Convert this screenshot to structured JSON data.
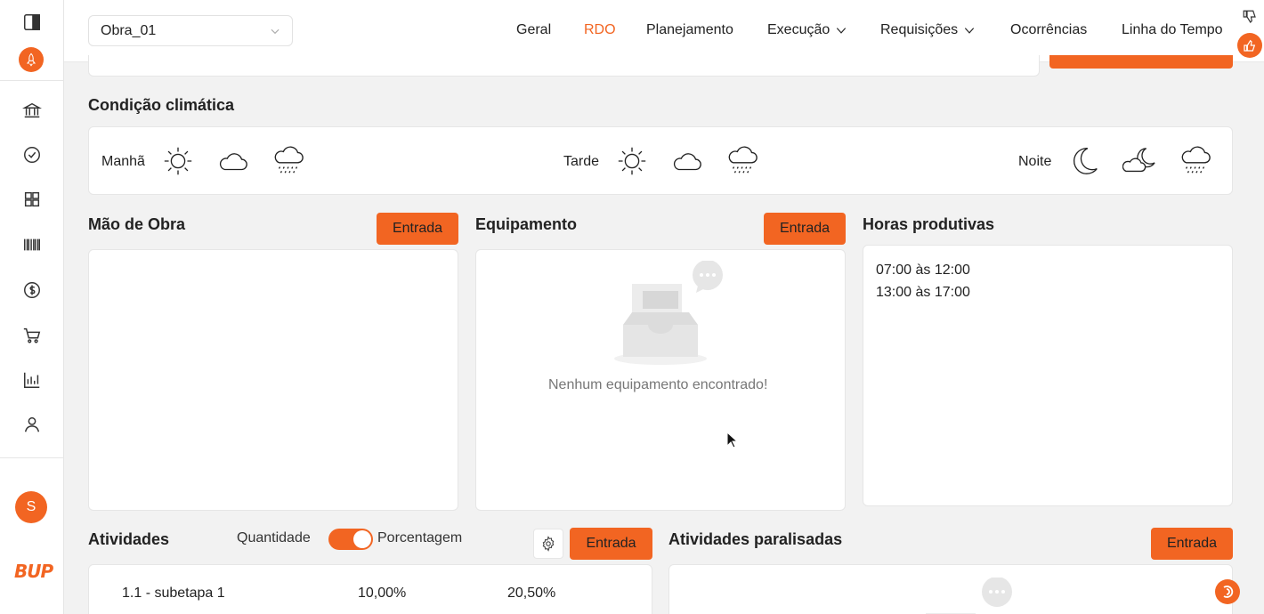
{
  "header": {
    "project": "Obra_01",
    "nav": [
      {
        "label": "Geral",
        "active": false
      },
      {
        "label": "RDO",
        "active": true
      },
      {
        "label": "Planejamento",
        "active": false
      },
      {
        "label": "Execução",
        "active": false,
        "dropdown": true
      },
      {
        "label": "Requisições",
        "active": false,
        "dropdown": true
      },
      {
        "label": "Ocorrências",
        "active": false
      },
      {
        "label": "Linha do Tempo",
        "active": false
      }
    ]
  },
  "sidebar": {
    "icons": [
      "panel-toggle-icon",
      "rocket-icon",
      "bank-icon",
      "check-circle-icon",
      "grid-icon",
      "barcode-icon",
      "dollar-icon",
      "cart-icon",
      "chart-icon",
      "user-icon"
    ],
    "avatar_initial": "S",
    "logo": "BUP"
  },
  "climate": {
    "title": "Condição climática",
    "periods": [
      {
        "label": "Manhã",
        "icons": [
          "sun-icon",
          "cloud-icon",
          "rain-cloud-icon"
        ]
      },
      {
        "label": "Tarde",
        "icons": [
          "sun-icon",
          "cloud-icon",
          "rain-cloud-icon"
        ]
      },
      {
        "label": "Noite",
        "icons": [
          "moon-icon",
          "cloud-moon-icon",
          "rain-cloud-icon"
        ]
      }
    ]
  },
  "labor": {
    "title": "Mão de Obra",
    "button": "Entrada"
  },
  "equipment": {
    "title": "Equipamento",
    "button": "Entrada",
    "empty": "Nenhum equipamento encontrado!"
  },
  "hours": {
    "title": "Horas produtivas",
    "lines": [
      "07:00 às 12:00",
      "13:00 às 17:00"
    ]
  },
  "activities": {
    "title": "Atividades",
    "toggle_left": "Quantidade",
    "toggle_right": "Porcentagem",
    "button": "Entrada",
    "rows": [
      {
        "name": "1.1 - subetapa 1",
        "v1": "10,00%",
        "v2": "20,50%"
      }
    ]
  },
  "paused": {
    "title": "Atividades paralisadas",
    "button": "Entrada"
  },
  "colors": {
    "accent": "#f26522"
  }
}
